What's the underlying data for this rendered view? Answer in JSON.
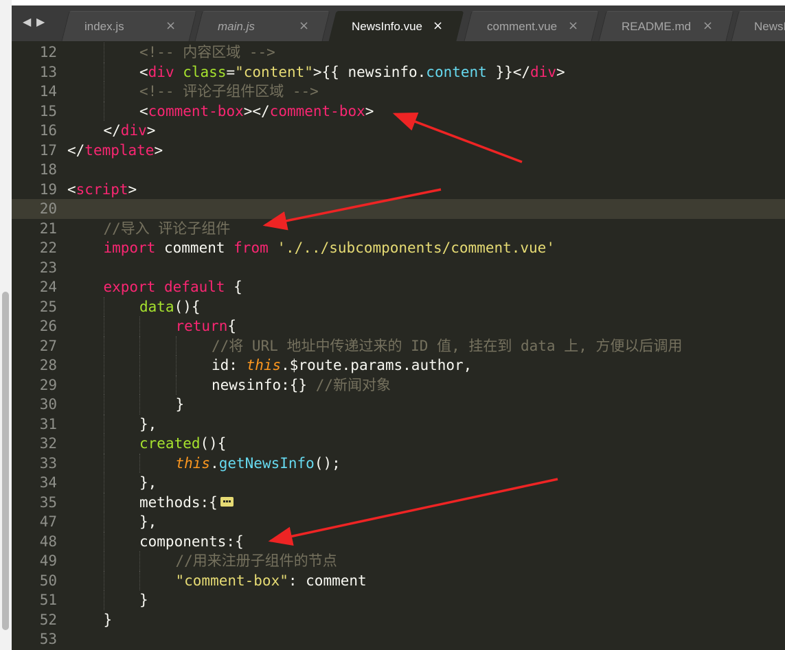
{
  "window": {
    "nav_back": "◀",
    "nav_forward": "▶"
  },
  "tabs": [
    {
      "label": "index.js",
      "italic": false,
      "active": false
    },
    {
      "label": "main.js",
      "italic": true,
      "active": false
    },
    {
      "label": "NewsInfo.vue",
      "italic": false,
      "active": true
    },
    {
      "label": "comment.vue",
      "italic": false,
      "active": false
    },
    {
      "label": "README.md",
      "italic": false,
      "active": false
    },
    {
      "label": "NewsList.vue",
      "italic": false,
      "active": false
    }
  ],
  "tab_close_glyph": "×",
  "editor": {
    "current_line": "20",
    "lines": [
      {
        "num": "12",
        "indent": 2,
        "tokens": [
          [
            "c",
            "<!-- 内容区域 -->"
          ]
        ]
      },
      {
        "num": "13",
        "indent": 2,
        "tokens": [
          [
            "p",
            "<"
          ],
          [
            "t",
            "div"
          ],
          [
            "p",
            " "
          ],
          [
            "a",
            "class"
          ],
          [
            "p",
            "="
          ],
          [
            "s",
            "\"content\""
          ],
          [
            "p",
            ">{{ newsinfo."
          ],
          [
            "b",
            "content"
          ],
          [
            "p",
            " }}</"
          ],
          [
            "t",
            "div"
          ],
          [
            "p",
            ">"
          ]
        ]
      },
      {
        "num": "14",
        "indent": 2,
        "tokens": [
          [
            "c",
            "<!-- 评论子组件区域 -->"
          ]
        ]
      },
      {
        "num": "15",
        "indent": 2,
        "tokens": [
          [
            "p",
            "<"
          ],
          [
            "t",
            "comment-box"
          ],
          [
            "p",
            "></"
          ],
          [
            "t",
            "comment-box"
          ],
          [
            "p",
            ">"
          ]
        ]
      },
      {
        "num": "16",
        "indent": 1,
        "tokens": [
          [
            "p",
            "</"
          ],
          [
            "t",
            "div"
          ],
          [
            "p",
            ">"
          ]
        ]
      },
      {
        "num": "17",
        "indent": 0,
        "tokens": [
          [
            "p",
            "</"
          ],
          [
            "t",
            "template"
          ],
          [
            "p",
            ">"
          ]
        ]
      },
      {
        "num": "18",
        "indent": 0,
        "tokens": []
      },
      {
        "num": "19",
        "indent": 0,
        "tokens": [
          [
            "p",
            "<"
          ],
          [
            "t",
            "script"
          ],
          [
            "p",
            ">"
          ]
        ]
      },
      {
        "num": "20",
        "indent": 0,
        "tokens": []
      },
      {
        "num": "21",
        "indent": 1,
        "tokens": [
          [
            "c",
            "//导入 评论子组件"
          ]
        ]
      },
      {
        "num": "22",
        "indent": 1,
        "tokens": [
          [
            "k",
            "import"
          ],
          [
            "p",
            " comment "
          ],
          [
            "k",
            "from"
          ],
          [
            "p",
            " "
          ],
          [
            "s",
            "'./../subcomponents/comment.vue'"
          ]
        ]
      },
      {
        "num": "23",
        "indent": 0,
        "tokens": []
      },
      {
        "num": "24",
        "indent": 1,
        "tokens": [
          [
            "k",
            "export"
          ],
          [
            "p",
            " "
          ],
          [
            "k",
            "default"
          ],
          [
            "p",
            " {"
          ]
        ]
      },
      {
        "num": "25",
        "indent": 2,
        "tokens": [
          [
            "f",
            "data"
          ],
          [
            "p",
            "(){"
          ]
        ]
      },
      {
        "num": "26",
        "indent": 3,
        "tokens": [
          [
            "k",
            "return"
          ],
          [
            "p",
            "{"
          ]
        ]
      },
      {
        "num": "27",
        "indent": 4,
        "tokens": [
          [
            "c",
            "//将 URL 地址中传递过来的 ID 值, 挂在到 data 上, 方便以后调用"
          ]
        ]
      },
      {
        "num": "28",
        "indent": 4,
        "tokens": [
          [
            "p",
            "id: "
          ],
          [
            "v",
            "this"
          ],
          [
            "p",
            ".$route.params.author,"
          ]
        ]
      },
      {
        "num": "29",
        "indent": 4,
        "tokens": [
          [
            "p",
            "newsinfo:{} "
          ],
          [
            "c",
            "//新闻对象"
          ]
        ]
      },
      {
        "num": "30",
        "indent": 3,
        "tokens": [
          [
            "p",
            "}"
          ]
        ]
      },
      {
        "num": "31",
        "indent": 2,
        "tokens": [
          [
            "p",
            "},"
          ]
        ]
      },
      {
        "num": "32",
        "indent": 2,
        "tokens": [
          [
            "f",
            "created"
          ],
          [
            "p",
            "(){"
          ]
        ]
      },
      {
        "num": "33",
        "indent": 3,
        "tokens": [
          [
            "v",
            "this"
          ],
          [
            "p",
            "."
          ],
          [
            "b",
            "getNewsInfo"
          ],
          [
            "p",
            "();"
          ]
        ]
      },
      {
        "num": "34",
        "indent": 2,
        "tokens": [
          [
            "p",
            "},"
          ]
        ]
      },
      {
        "num": "35",
        "indent": 2,
        "tokens": [
          [
            "p",
            "methods:{"
          ]
        ],
        "fold": true
      },
      {
        "num": "47",
        "indent": 2,
        "tokens": [
          [
            "p",
            "},"
          ]
        ]
      },
      {
        "num": "48",
        "indent": 2,
        "tokens": [
          [
            "p",
            "components:{"
          ]
        ]
      },
      {
        "num": "49",
        "indent": 3,
        "tokens": [
          [
            "c",
            "//用来注册子组件的节点"
          ]
        ]
      },
      {
        "num": "50",
        "indent": 3,
        "tokens": [
          [
            "s",
            "\"comment-box\""
          ],
          [
            "p",
            ": comment"
          ]
        ]
      },
      {
        "num": "51",
        "indent": 2,
        "tokens": [
          [
            "p",
            "}"
          ]
        ]
      },
      {
        "num": "52",
        "indent": 1,
        "tokens": [
          [
            "p",
            "}"
          ]
        ]
      },
      {
        "num": "53",
        "indent": 0,
        "tokens": []
      }
    ]
  },
  "colors": {
    "background": "#272822",
    "comment": "#75715e",
    "tag": "#f92672",
    "attribute": "#a6e22e",
    "string": "#e6db74",
    "support": "#66d9ef",
    "this": "#fd971f",
    "arrow": "#ee2424"
  }
}
